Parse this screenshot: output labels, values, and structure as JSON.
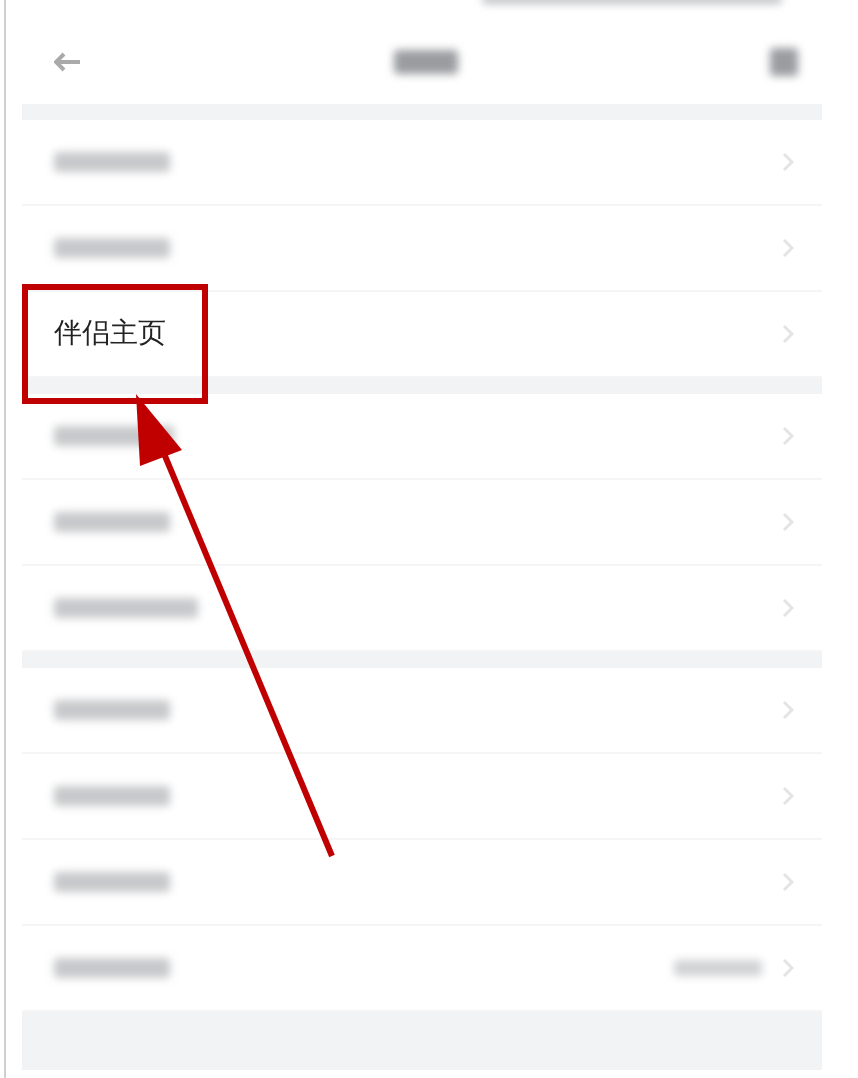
{
  "groups": [
    {
      "items": [
        {
          "kind": "blurred"
        },
        {
          "kind": "blurred"
        },
        {
          "kind": "text",
          "label": "伴侣主页",
          "highlighted": true
        }
      ]
    },
    {
      "items": [
        {
          "kind": "blurred"
        },
        {
          "kind": "blurred"
        },
        {
          "kind": "blurred"
        }
      ]
    },
    {
      "items": [
        {
          "kind": "blurred"
        },
        {
          "kind": "blurred"
        },
        {
          "kind": "blurred"
        },
        {
          "kind": "blurred_value"
        }
      ]
    }
  ],
  "annotation": {
    "kind": "arrow"
  }
}
